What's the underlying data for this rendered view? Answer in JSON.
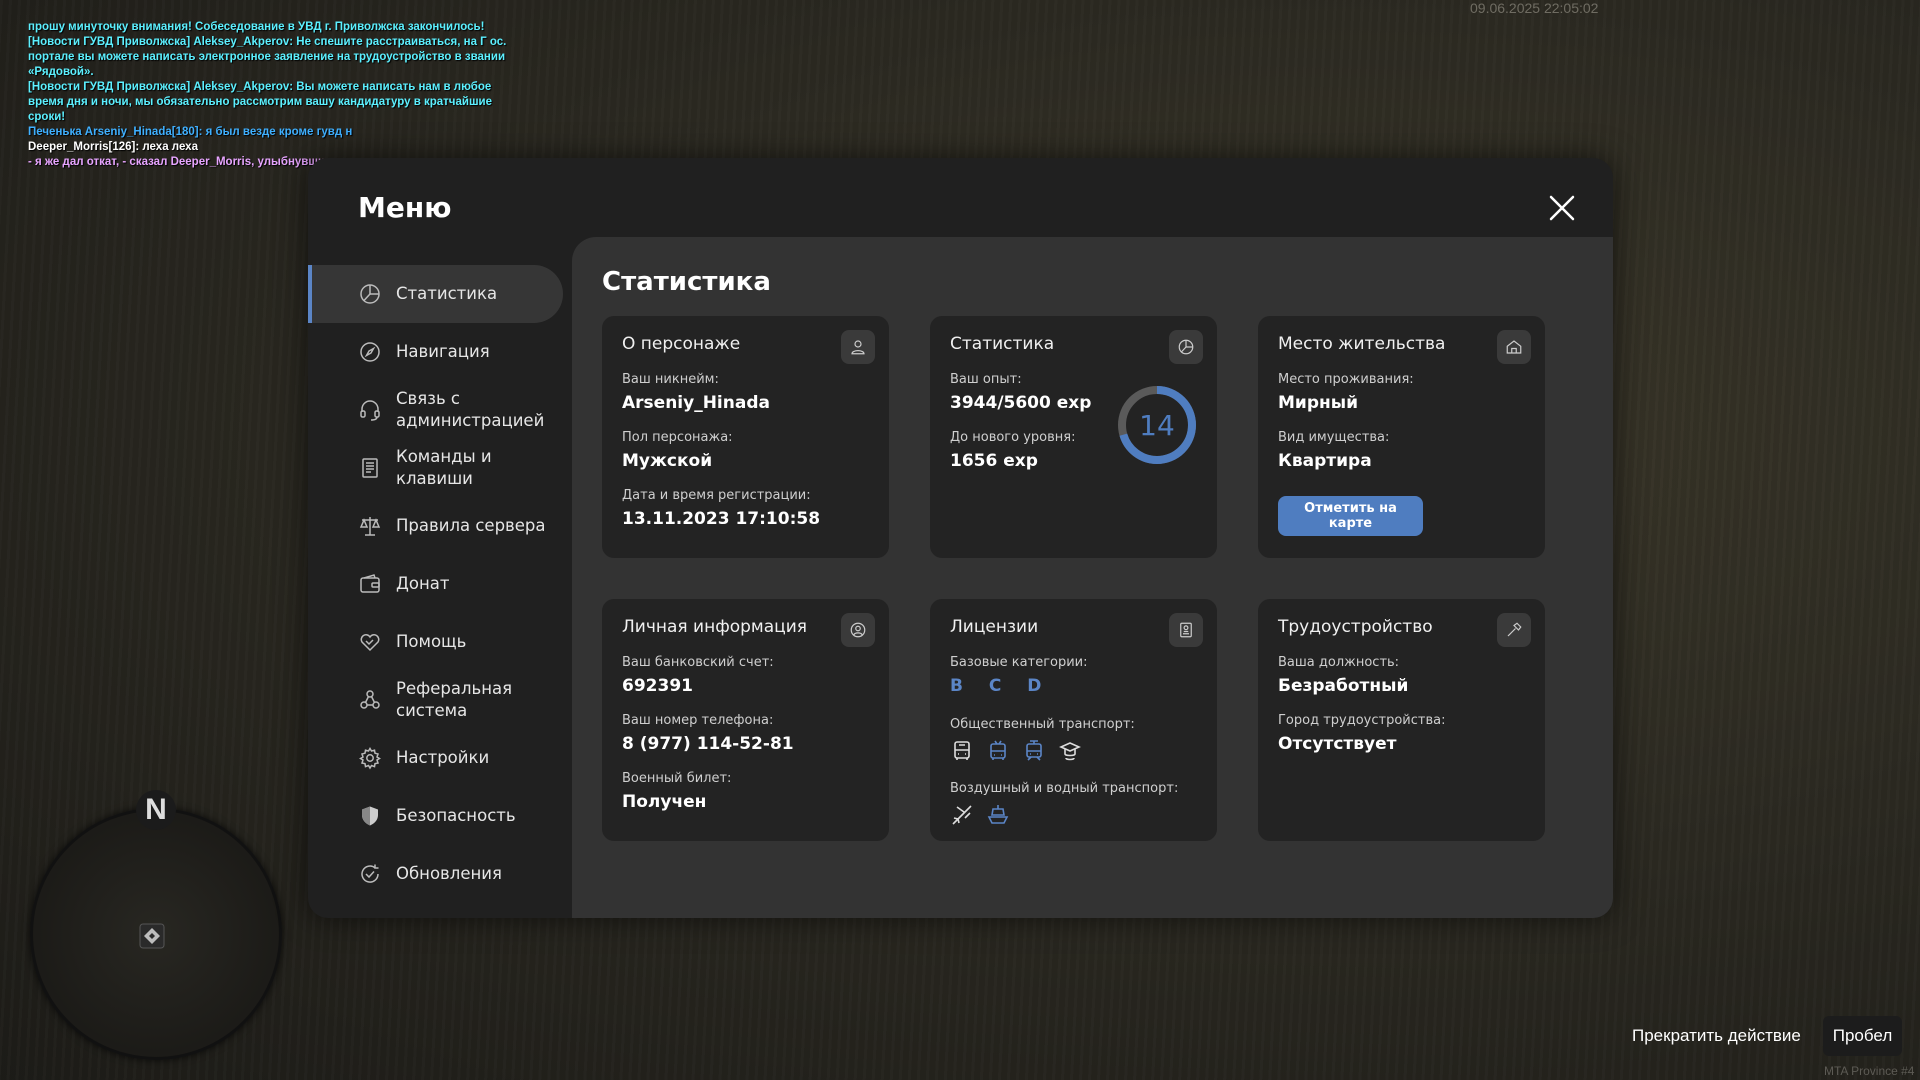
{
  "hud": {
    "timestamp": "09.06.2025 22:05:02",
    "server_tag": "MTA Province #4",
    "compass_label": "N",
    "hint": {
      "label": "Прекратить действие",
      "key": "Пробел"
    }
  },
  "chat": [
    {
      "text": "прошу минуточку внимания! Собеседование в УВД г. Приволжска закончилось!",
      "color": "#5cf0ff"
    },
    {
      "text": "[Новости ГУВД Приволжска] Aleksey_Akperov: Не спешите расстраиваться, на Г ос. портале вы можете написать электронное заявление на трудоустройство в звании «Рядовой».",
      "color": "#5cf0ff"
    },
    {
      "text": "[Новости ГУВД Приволжска] Aleksey_Akperov: Вы можете написать нам в любое время дня и ночи, мы обязательно рассмотрим вашу кандидатуру в кратчайшие сроки!",
      "color": "#5cf0ff"
    },
    {
      "text": "Печенька Arseniy_Hinada[180]: я был везде кроме гувд н",
      "color": "#3fb0ff"
    },
    {
      "text": "Deeper_Morris[126]: леха леха",
      "color": "#ffffff"
    },
    {
      "text": "- я же дал откат, - сказал Deeper_Morris, улыбнувшись.",
      "color": "#e7a4ff"
    }
  ],
  "menu": {
    "title": "Меню",
    "sidebar": [
      {
        "label": "Статистика",
        "icon": "pie-chart-icon"
      },
      {
        "label": "Навигация",
        "icon": "compass-icon"
      },
      {
        "label": "Связь с администрацией",
        "icon": "headset-icon"
      },
      {
        "label": "Команды и клавиши",
        "icon": "document-icon"
      },
      {
        "label": "Правила сервера",
        "icon": "scales-icon"
      },
      {
        "label": "Донат",
        "icon": "wallet-icon"
      },
      {
        "label": "Помощь",
        "icon": "handshake-heart-icon"
      },
      {
        "label": "Реферальная система",
        "icon": "referral-icon"
      },
      {
        "label": "Настройки",
        "icon": "gear-icon"
      },
      {
        "label": "Безопасность",
        "icon": "shield-icon"
      },
      {
        "label": "Обновления",
        "icon": "refresh-check-icon"
      }
    ],
    "content_title": "Статистика",
    "cards": {
      "character": {
        "title": "О персонаже",
        "nick_label": "Ваш никнейм:",
        "nick": "Arseniy_Hinada",
        "gender_label": "Пол персонажа:",
        "gender": "Мужской",
        "reg_label": "Дата и время регистрации:",
        "reg": "13.11.2023 17:10:58"
      },
      "stats": {
        "title": "Статистика",
        "exp_label": "Ваш опыт:",
        "exp": "3944/5600 exp",
        "next_label": "До нового уровня:",
        "next": "1656 exp",
        "level": "14",
        "progress": 0.704
      },
      "residence": {
        "title": "Место жительства",
        "place_label": "Место проживания:",
        "place": "Мирный",
        "property_label": "Вид имущества:",
        "property": "Квартира",
        "map_button": "Отметить на карте"
      },
      "personal": {
        "title": "Личная информация",
        "bank_label": "Ваш банковский счет:",
        "bank": "692391",
        "phone_label": "Ваш номер телефона:",
        "phone": "8 (977) 114-52-81",
        "military_label": "Военный билет:",
        "military": "Получен"
      },
      "licenses": {
        "title": "Лицензии",
        "base_label": "Базовые категории:",
        "base": "B C D",
        "public_label": "Общественный транспорт:",
        "air_label": "Воздушный и водный транспорт:",
        "accent": "#5b85c6"
      },
      "employment": {
        "title": "Трудоустройство",
        "position_label": "Ваша должность:",
        "position": "Безработный",
        "city_label": "Город трудоустройства:",
        "city": "Отсутствует"
      }
    }
  }
}
